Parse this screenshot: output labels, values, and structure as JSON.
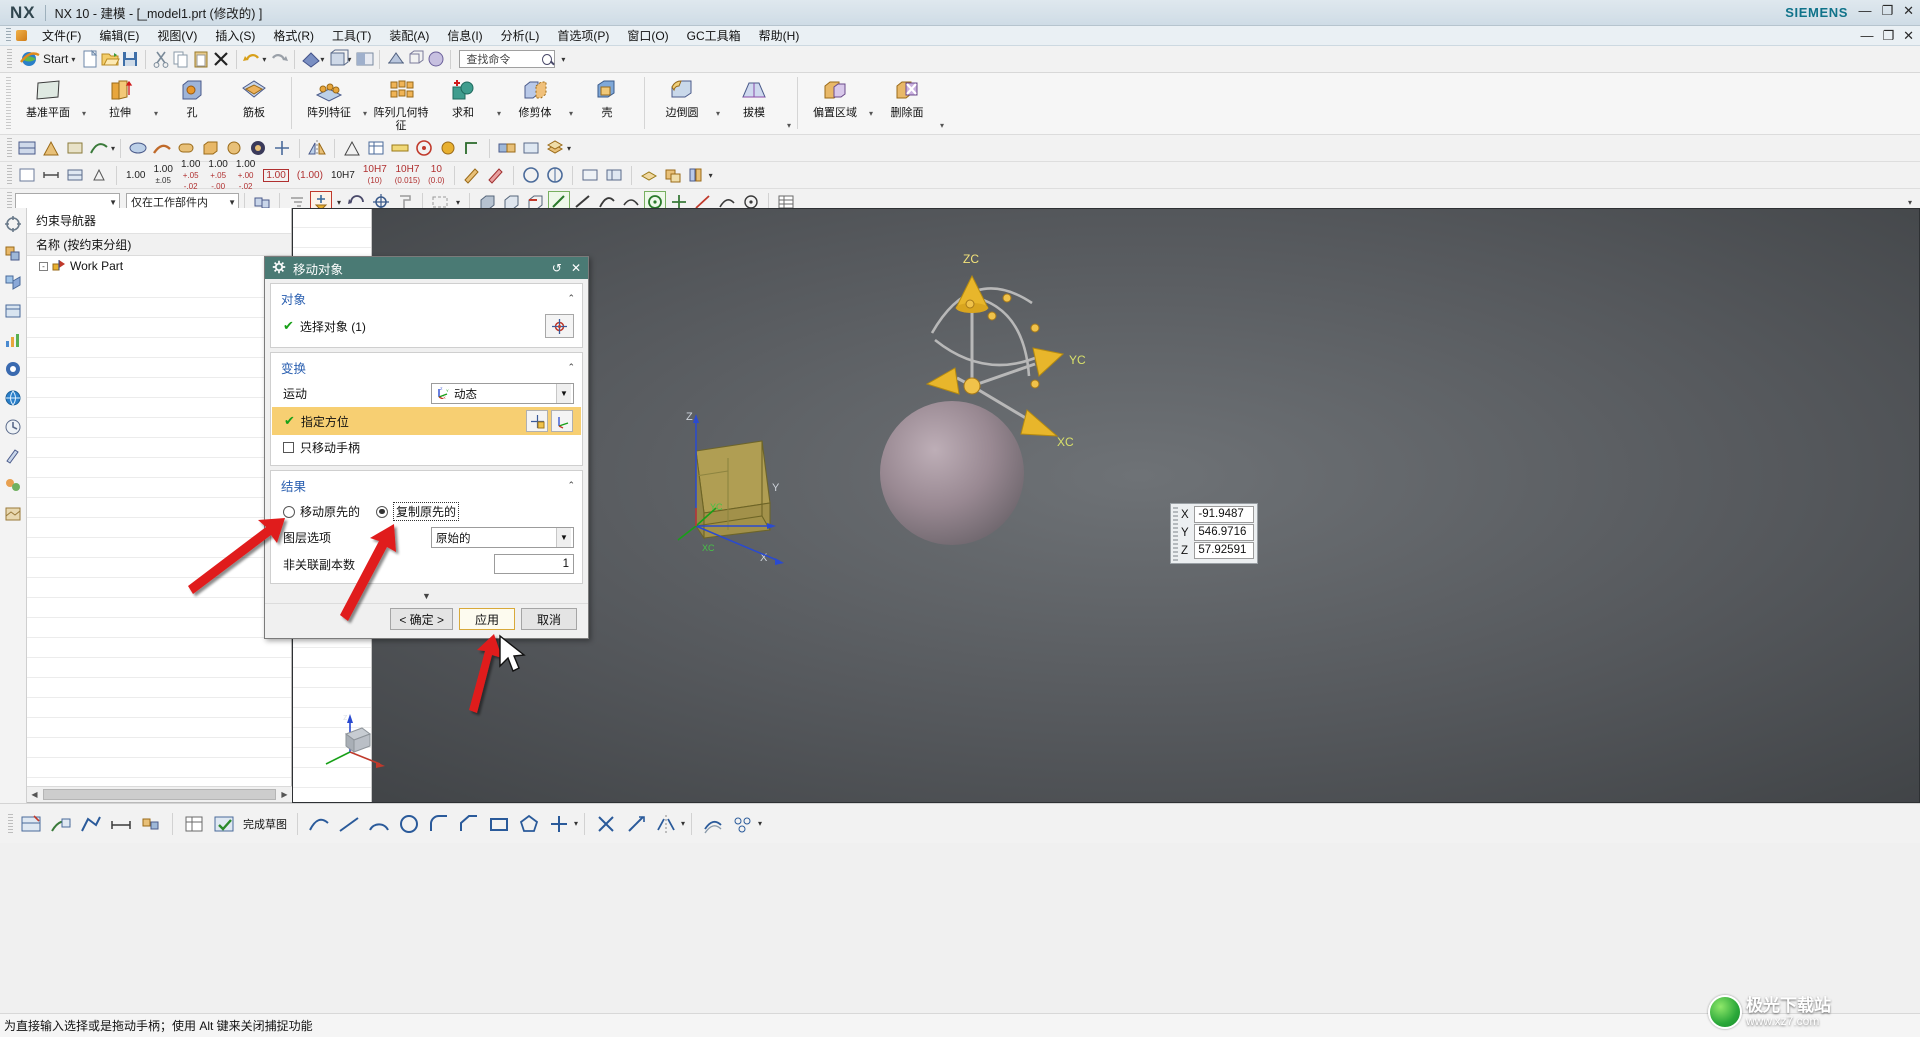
{
  "window": {
    "logo": "NX",
    "title": "NX 10 - 建模 - [_model1.prt  (修改的)  ]",
    "brand": "SIEMENS",
    "minimize": "—",
    "maximize": "❐",
    "close": "✕",
    "minimize2": "—",
    "maximize2": "❐",
    "close2": "✕"
  },
  "menubar": {
    "items": [
      {
        "label": "文件(F)"
      },
      {
        "label": "编辑(E)"
      },
      {
        "label": "视图(V)"
      },
      {
        "label": "插入(S)"
      },
      {
        "label": "格式(R)"
      },
      {
        "label": "工具(T)"
      },
      {
        "label": "装配(A)"
      },
      {
        "label": "信息(I)"
      },
      {
        "label": "分析(L)"
      },
      {
        "label": "首选项(P)"
      },
      {
        "label": "窗口(O)"
      },
      {
        "label": "GC工具箱"
      },
      {
        "label": "帮助(H)"
      }
    ]
  },
  "quickbar": {
    "start_label": "Start",
    "search": {
      "value": "查找命令",
      "placeholder": "查找命令"
    },
    "icons": [
      "new-file-icon",
      "open-file-icon",
      "save-icon",
      "cut-icon",
      "copy-icon",
      "paste-icon",
      "undo-icon",
      "redo-icon",
      "render-style-icon",
      "layer-icon",
      "view-section-icon"
    ]
  },
  "ribbon": {
    "groups": [
      {
        "buttons": [
          {
            "label": "基准平面",
            "icon": "datum-plane-icon",
            "caret": true
          },
          {
            "label": "拉伸",
            "icon": "extrude-icon",
            "caret": true
          },
          {
            "label": "孔",
            "icon": "hole-icon",
            "caret": false
          },
          {
            "label": "筋板",
            "icon": "rib-icon",
            "caret": false
          }
        ]
      },
      {
        "buttons": [
          {
            "label": "阵列特征",
            "icon": "pattern-feature-icon",
            "caret": true
          },
          {
            "label": "阵列几何特征",
            "icon": "pattern-geometry-icon",
            "caret": false
          },
          {
            "label": "求和",
            "icon": "unite-icon",
            "caret": true
          },
          {
            "label": "修剪体",
            "icon": "trim-body-icon",
            "caret": true
          },
          {
            "label": "壳",
            "icon": "shell-icon",
            "caret": false
          }
        ]
      },
      {
        "buttons": [
          {
            "label": "边倒圆",
            "icon": "edge-blend-icon",
            "caret": true
          },
          {
            "label": "拔模",
            "icon": "draft-icon",
            "caret": false
          }
        ]
      },
      {
        "buttons": [
          {
            "label": "偏置区域",
            "icon": "offset-region-icon",
            "caret": true
          },
          {
            "label": "删除面",
            "icon": "delete-face-icon",
            "caret": false
          }
        ]
      }
    ]
  },
  "tolerance_toolbar": {
    "values": [
      "1.00",
      "1.00\n±.05",
      "1.00\n+.05\n-.02",
      "1.00\n+.05\n-.00",
      "1.00\n+.00\n-.02",
      "1.00",
      "(1.00)",
      "10H7",
      "10H7\n(10)",
      "10H7\n(0.015)",
      "10\n(0.0)"
    ]
  },
  "filterbar": {
    "filter_value": "",
    "scope_value": "仅在工作部件内"
  },
  "navigator": {
    "title": "约束导航器",
    "column_header": "名称 (按约束分组)",
    "tree": [
      {
        "label": "Work Part",
        "expander": "-",
        "icon": "work-part-icon"
      }
    ],
    "scroll_left": "◀",
    "scroll_right": "▶"
  },
  "resource_bar": {
    "icons": [
      "assembly-navigator-icon",
      "constraint-navigator-icon",
      "part-navigator-icon",
      "reuse-library-icon",
      "history-chart-icon",
      "hd3d-icon",
      "web-browser-icon",
      "history-icon",
      "roles-icon",
      "system-materials-icon",
      "system-scenes-icon"
    ]
  },
  "dialog": {
    "title": "移动对象",
    "title_icon": "gear-icon",
    "restore_icon": "↺",
    "close_icon": "✕",
    "sections": [
      {
        "name": "对象",
        "collapse": "⌃",
        "select_label": "选择对象 (1)",
        "select_icon": "select-object-icon"
      },
      {
        "name": "变换",
        "collapse": "⌃",
        "motion_label": "运动",
        "motion_value": "动态",
        "motion_icon": "dynamic-csys-icon",
        "specify_orientation_label": "指定方位",
        "only_move_handle_label": "只移动手柄",
        "only_move_handle_checked": false,
        "btn_point_icon": "point-constructor-icon",
        "btn_csys_icon": "csys-dialog-icon"
      },
      {
        "name": "结果",
        "collapse": "⌃",
        "radio_move_label": "移动原先的",
        "radio_copy_label": "复制原先的",
        "radio_selected": "复制原先的",
        "layer_option_label": "图层选项",
        "layer_option_value": "原始的",
        "copies_label": "非关联副本数",
        "copies_value": "1"
      }
    ],
    "more_caret": "▼",
    "buttons": {
      "ok": "< 确定 >",
      "apply": "应用",
      "cancel": "取消"
    }
  },
  "coordinate_popup": {
    "rows": [
      {
        "axis": "X",
        "value": "-91.9487"
      },
      {
        "axis": "Y",
        "value": "546.9716"
      },
      {
        "axis": "Z",
        "value": "57.92591"
      }
    ]
  },
  "viewport": {
    "wcs_labels": {
      "zc": "ZC",
      "yc": "YC",
      "xc": "XC"
    },
    "triad_labels": {
      "x": "X",
      "y": "Y",
      "z": "Z"
    },
    "origin_labels": {
      "xc": "XC",
      "yc": "YC"
    }
  },
  "bottombar": {
    "finish_sketch_label": "完成草图",
    "icons": [
      "sketch-icon",
      "profile-icon",
      "rapid-dimension-icon",
      "geometric-constraint-icon",
      "sketch-settings-icon",
      "finish-sketch-icon",
      "line-icon",
      "arc-icon",
      "circle-icon",
      "fillet-icon",
      "chamfer-icon",
      "rectangle-icon",
      "polygon-icon",
      "trim-icon",
      "extend-icon",
      "mirror-icon",
      "offset-curve-icon"
    ]
  },
  "statusbar": {
    "message": "为直接输入选择或是拖动手柄；使用 Alt 键来关闭捕捉功能"
  },
  "watermark": {
    "line1": "极光下载站",
    "line2": "www.xz7.com"
  },
  "colors": {
    "dialog_title_bg": "#4a7a74",
    "highlight_row": "#f7cf72",
    "group_label": "#2a5fb0",
    "accent_green": "#18a018",
    "apply_border": "#d8a93a",
    "annotation_arrow": "#e01b1b",
    "siemens_teal": "#10738a"
  }
}
